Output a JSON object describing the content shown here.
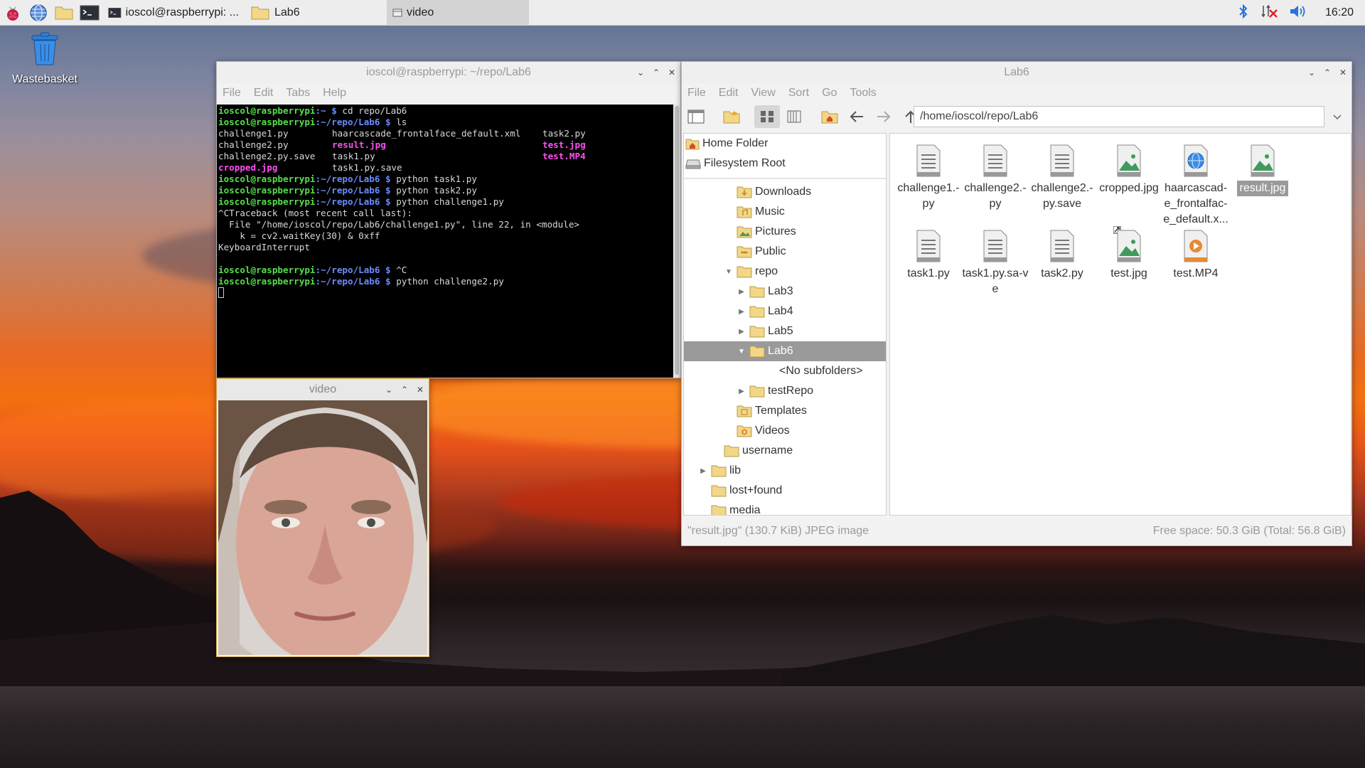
{
  "taskbar": {
    "tasks": [
      {
        "label": "ioscol@raspberrypi: ..."
      },
      {
        "label": "Lab6"
      },
      {
        "label": "video"
      }
    ],
    "clock": "16:20"
  },
  "desktop": {
    "wastebasket_label": "Wastebasket"
  },
  "terminal": {
    "title": "ioscol@raspberrypi: ~/repo/Lab6",
    "menu": [
      "File",
      "Edit",
      "Tabs",
      "Help"
    ],
    "prompt_user": "ioscol@raspberrypi",
    "lines": {
      "l1_path": ":~ $ ",
      "l1_cmd": "cd repo/Lab6",
      "l2_path": ":~/repo/Lab6 $ ",
      "l2_cmd": "ls",
      "ls_r1": [
        "challenge1.py",
        "haarcascade_frontalface_default.xml",
        "task2.py"
      ],
      "ls_r2": [
        "challenge2.py",
        "result.jpg",
        "test.jpg"
      ],
      "ls_r3": [
        "challenge2.py.save",
        "task1.py",
        "test.MP4"
      ],
      "ls_r4": [
        "cropped.jpg",
        "task1.py.save"
      ],
      "l3_cmd": "python task1.py",
      "l4_cmd": "python task2.py",
      "l5_cmd": "python challenge1.py",
      "tb1": "^CTraceback (most recent call last):",
      "tb2": "  File \"/home/ioscol/repo/Lab6/challenge1.py\", line 22, in <module>",
      "tb3": "    k = cv2.waitKey(30) & 0xff",
      "tb4": "KeyboardInterrupt",
      "l6_cmd": "^C",
      "l7_cmd": "python challenge2.py"
    }
  },
  "video_window": {
    "title": "video"
  },
  "file_manager": {
    "title": "Lab6",
    "menu": [
      "File",
      "Edit",
      "View",
      "Sort",
      "Go",
      "Tools"
    ],
    "address": "/home/ioscol/repo/Lab6",
    "places": [
      {
        "label": "Home Folder"
      },
      {
        "label": "Filesystem Root"
      }
    ],
    "tree": [
      {
        "label": "Downloads"
      },
      {
        "label": "Music"
      },
      {
        "label": "Pictures"
      },
      {
        "label": "Public"
      },
      {
        "label": "repo"
      },
      {
        "label": "Lab3"
      },
      {
        "label": "Lab4"
      },
      {
        "label": "Lab5"
      },
      {
        "label": "Lab6"
      },
      {
        "label": "<No subfolders>"
      },
      {
        "label": "testRepo"
      },
      {
        "label": "Templates"
      },
      {
        "label": "Videos"
      },
      {
        "label": "username"
      },
      {
        "label": "lib"
      },
      {
        "label": "lost+found"
      },
      {
        "label": "media"
      }
    ],
    "files": [
      {
        "name": "challenge1.-py",
        "type": "text"
      },
      {
        "name": "challenge2.-py",
        "type": "text"
      },
      {
        "name": "challenge2.-py.save",
        "type": "text"
      },
      {
        "name": "cropped.jpg",
        "type": "image"
      },
      {
        "name": "haarcascad-e_frontalfac-e_default.x...",
        "type": "web"
      },
      {
        "name": "result.jpg",
        "type": "image"
      },
      {
        "name": "task1.py",
        "type": "text"
      },
      {
        "name": "task1.py.sa-ve",
        "type": "text"
      },
      {
        "name": "task2.py",
        "type": "text"
      },
      {
        "name": "test.jpg",
        "type": "image"
      },
      {
        "name": "test.MP4",
        "type": "video"
      }
    ],
    "status_left": "\"result.jpg\" (130.7 KiB) JPEG image",
    "status_right": "Free space: 50.3 GiB (Total: 56.8 GiB)"
  },
  "colors": {
    "terminal_bg": "#000000",
    "prompt_user": "#55e04a",
    "prompt_path": "#6b8cff",
    "media_file": "#ff4ff0",
    "video_file": "#3fe0ff",
    "selection": "#9a9a9a",
    "video_border": "#d9a640"
  }
}
